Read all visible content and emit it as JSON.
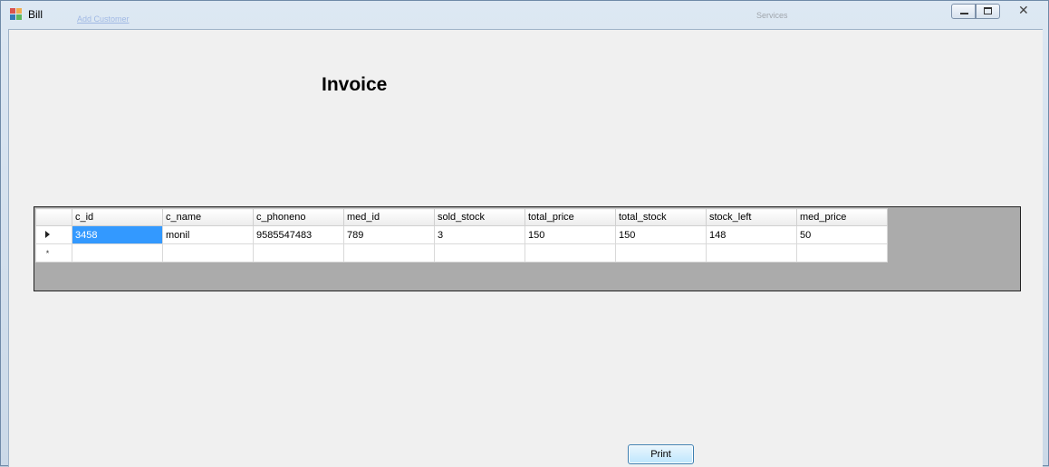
{
  "window": {
    "title": "Bill",
    "background_link": "Add Customer",
    "background_fragments": [
      "Services"
    ]
  },
  "main": {
    "heading": "Invoice",
    "print_label": "Print"
  },
  "grid": {
    "columns": [
      "c_id",
      "c_name",
      "c_phoneno",
      "med_id",
      "sold_stock",
      "total_price",
      "total_stock",
      "stock_left",
      "med_price"
    ],
    "rows": [
      [
        "3458",
        "monil",
        "9585547483",
        "789",
        "3",
        "150",
        "150",
        "148",
        "50"
      ]
    ],
    "new_row_marker": "*",
    "selected_color": "#3399ff",
    "background_color": "#ababab"
  }
}
